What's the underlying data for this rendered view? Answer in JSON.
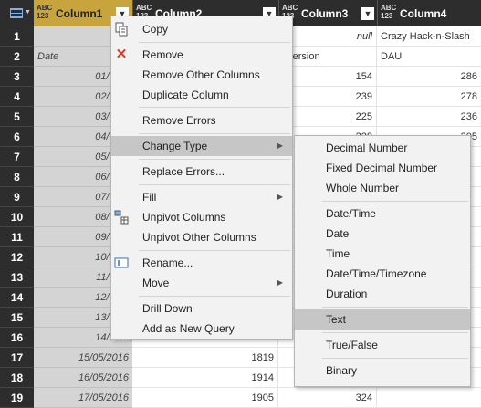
{
  "columns": {
    "col1": {
      "type_top": "ABC",
      "type_bottom": "123",
      "name": "Column1"
    },
    "col2": {
      "type_top": "ABC",
      "type_bottom": "123",
      "name": "Column2"
    },
    "col3": {
      "type_top": "ABC",
      "type_bottom": "123",
      "name": "Column3"
    },
    "col4": {
      "type_top": "ABC",
      "type_bottom": "123",
      "name": "Column4"
    }
  },
  "header_row1": {
    "col3": "null",
    "col4": "Crazy Hack-n-Slash"
  },
  "header_row2": {
    "col1": "Date",
    "col3": "nversion",
    "col4": "DAU"
  },
  "rows": [
    {
      "n": "1",
      "c1": "",
      "c2": "",
      "c3": "null",
      "c4": "Crazy Hack-n-Slash"
    },
    {
      "n": "2",
      "c1": "Date",
      "c2": "",
      "c3": "nversion",
      "c4": "DAU"
    },
    {
      "n": "3",
      "c1": "01/05/2",
      "c2": "",
      "c3": "154",
      "c4": "286"
    },
    {
      "n": "4",
      "c1": "02/05/2",
      "c2": "",
      "c3": "239",
      "c4": "278"
    },
    {
      "n": "5",
      "c1": "03/05/2",
      "c2": "",
      "c3": "225",
      "c4": "236"
    },
    {
      "n": "6",
      "c1": "04/05/2",
      "c2": "",
      "c3": "228",
      "c4": "205"
    },
    {
      "n": "7",
      "c1": "05/05/2",
      "c2": "",
      "c3": "",
      "c4": ""
    },
    {
      "n": "8",
      "c1": "06/05/2",
      "c2": "",
      "c3": "",
      "c4": ""
    },
    {
      "n": "9",
      "c1": "07/05/2",
      "c2": "",
      "c3": "",
      "c4": ""
    },
    {
      "n": "10",
      "c1": "08/05/2",
      "c2": "",
      "c3": "",
      "c4": ""
    },
    {
      "n": "11",
      "c1": "09/05/2",
      "c2": "",
      "c3": "",
      "c4": ""
    },
    {
      "n": "12",
      "c1": "10/05/2",
      "c2": "",
      "c3": "",
      "c4": ""
    },
    {
      "n": "13",
      "c1": "11/05/2",
      "c2": "",
      "c3": "",
      "c4": ""
    },
    {
      "n": "14",
      "c1": "12/05/2",
      "c2": "",
      "c3": "",
      "c4": ""
    },
    {
      "n": "15",
      "c1": "13/05/2",
      "c2": "",
      "c3": "",
      "c4": ""
    },
    {
      "n": "16",
      "c1": "14/05/2",
      "c2": "",
      "c3": "",
      "c4": ""
    },
    {
      "n": "17",
      "c1": "15/05/2016",
      "c2": "1819",
      "c3": "",
      "c4": ""
    },
    {
      "n": "18",
      "c1": "16/05/2016",
      "c2": "1914",
      "c3": "",
      "c4": ""
    },
    {
      "n": "19",
      "c1": "17/05/2016",
      "c2": "1905",
      "c3": "324",
      "c4": ""
    }
  ],
  "right_edge_values": [
    "286",
    "278",
    "236",
    "205",
    "",
    "",
    "",
    "",
    "",
    "",
    "",
    "",
    "",
    "",
    "",
    "",
    "",
    "",
    ""
  ],
  "context_menu": {
    "copy": "Copy",
    "remove": "Remove",
    "remove_other": "Remove Other Columns",
    "duplicate": "Duplicate Column",
    "remove_errors": "Remove Errors",
    "change_type": "Change Type",
    "replace_errors": "Replace Errors...",
    "fill": "Fill",
    "unpivot": "Unpivot Columns",
    "unpivot_other": "Unpivot Other Columns",
    "rename": "Rename...",
    "move": "Move",
    "drill_down": "Drill Down",
    "add_new_query": "Add as New Query"
  },
  "submenu": {
    "decimal": "Decimal Number",
    "fixed_decimal": "Fixed Decimal Number",
    "whole": "Whole Number",
    "datetime": "Date/Time",
    "date": "Date",
    "time": "Time",
    "datetimezone": "Date/Time/Timezone",
    "duration": "Duration",
    "text": "Text",
    "truefalse": "True/False",
    "binary": "Binary"
  },
  "colors": {
    "accent_header": "#c8a43c",
    "highlight": "#c6c6c6",
    "header_bg": "#2d2d2d"
  }
}
